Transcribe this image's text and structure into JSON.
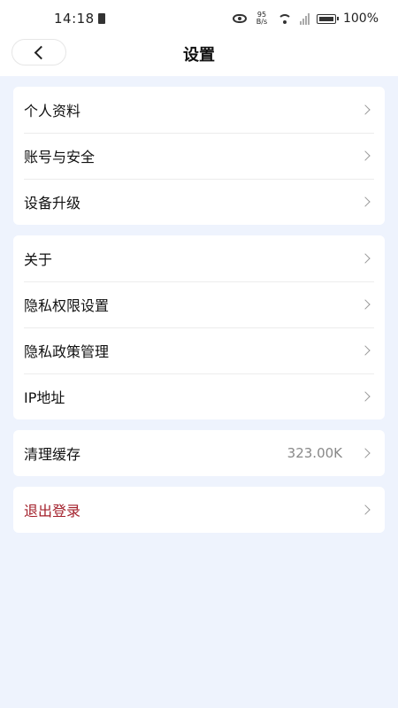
{
  "status_bar": {
    "time": "14:18",
    "net_speed_value": "95",
    "net_speed_unit": "B/s",
    "battery": "100%"
  },
  "header": {
    "title": "设置"
  },
  "groups": [
    {
      "items": [
        {
          "label": "个人资料"
        },
        {
          "label": "账号与安全"
        },
        {
          "label": "设备升级"
        }
      ]
    },
    {
      "items": [
        {
          "label": "关于"
        },
        {
          "label": "隐私权限设置"
        },
        {
          "label": "隐私政策管理"
        },
        {
          "label": "IP地址"
        }
      ]
    },
    {
      "items": [
        {
          "label": "清理缓存",
          "value": "323.00K"
        }
      ]
    },
    {
      "items": [
        {
          "label": "退出登录"
        }
      ]
    }
  ],
  "colors": {
    "background": "#eef3fd",
    "logout_text": "#a3202b"
  }
}
